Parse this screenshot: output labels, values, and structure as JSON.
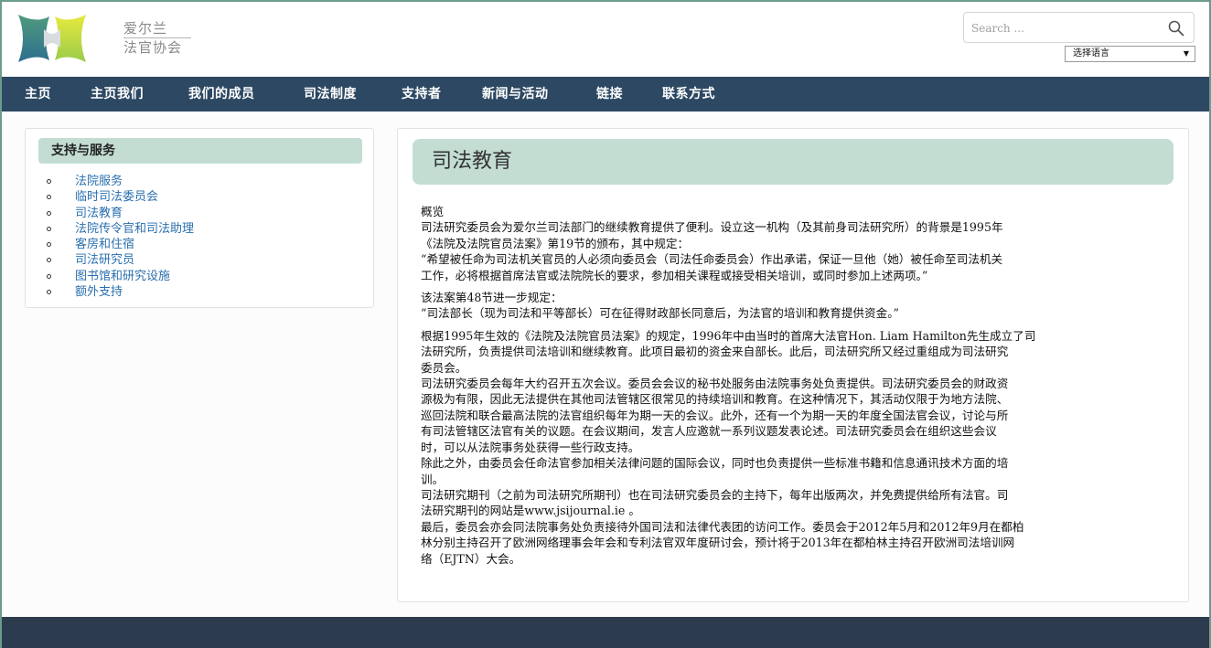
{
  "header": {
    "logo_line1": "爱尔兰",
    "logo_line2": "法官协会",
    "search_placeholder": "Search ...",
    "language_select": "选择语言"
  },
  "nav": {
    "items": [
      "主页",
      "主页我们",
      "我们的成员",
      "司法制度",
      "支持者",
      "新闻与活动",
      "链接",
      "联系方式"
    ]
  },
  "sidebar": {
    "title": "支持与服务",
    "items": [
      "法院服务",
      "临时司法委员会",
      "司法教育",
      "法院传令官和司法助理",
      "客房和住宿",
      "司法研究员",
      "图书馆和研究设施",
      "额外支持"
    ]
  },
  "main": {
    "title": "司法教育",
    "paragraphs": [
      [
        "概览",
        "司法研究委员会为爱尔兰司法部门的继续教育提供了便利。设立这一机构（及其前身司法研究所）的背景是1995年",
        "《法院及法院官员法案》第19节的颁布，其中规定：",
        "“希望被任命为司法机关官员的人必须向委员会（司法任命委员会）作出承诺，保证一旦他（她）被任命至司法机关",
        "工作，必将根据首席法官或法院院长的要求，参加相关课程或接受相关培训，或同时参加上述两项。”"
      ],
      [
        "该法案第48节进一步规定：",
        "“司法部长（现为司法和平等部长）可在征得财政部长同意后，为法官的培训和教育提供资金。”"
      ],
      [
        "根据1995年生效的《法院及法院官员法案》的规定，1996年中由当时的首席大法官Hon. Liam Hamilton先生成立了司",
        "法研究所，负责提供司法培训和继续教育。此项目最初的资金来自部长。此后，司法研究所又经过重组成为司法研究",
        "委员会。",
        "司法研究委员会每年大约召开五次会议。委员会会议的秘书处服务由法院事务处负责提供。司法研究委员会的财政资",
        "源极为有限，因此无法提供在其他司法管辖区很常见的持续培训和教育。在这种情况下，其活动仅限于为地方法院、",
        "巡回法院和联合最高法院的法官组织每年为期一天的会议。此外，还有一个为期一天的年度全国法官会议，讨论与所",
        "有司法管辖区法官有关的议题。在会议期间，发言人应邀就一系列议题发表论述。司法研究委员会在组织这些会议",
        "时，可以从法院事务处获得一些行政支持。",
        "除此之外，由委员会任命法官参加相关法律问题的国际会议，同时也负责提供一些标准书籍和信息通讯技术方面的培",
        "训。",
        "司法研究期刊（之前为司法研究所期刊）也在司法研究委员会的主持下，每年出版两次，并免费提供给所有法官。司",
        "法研究期刊的网站是www.jsijournal.ie 。",
        "最后，委员会亦会同法院事务处负责接待外国司法和法律代表团的访问工作。委员会于2012年5月和2012年9月在都柏",
        "林分别主持召开了欧洲网络理事会年会和专利法官双年度研讨会，预计将于2013年在都柏林主持召开欧洲司法培训网",
        "络（EJTN）大会。"
      ]
    ]
  },
  "colors": {
    "navbar": "#2c4862",
    "title_bg": "#c3ddd3",
    "link": "#2a6fae",
    "footer": "#2c3b4e",
    "border": "#6b9c8c"
  }
}
